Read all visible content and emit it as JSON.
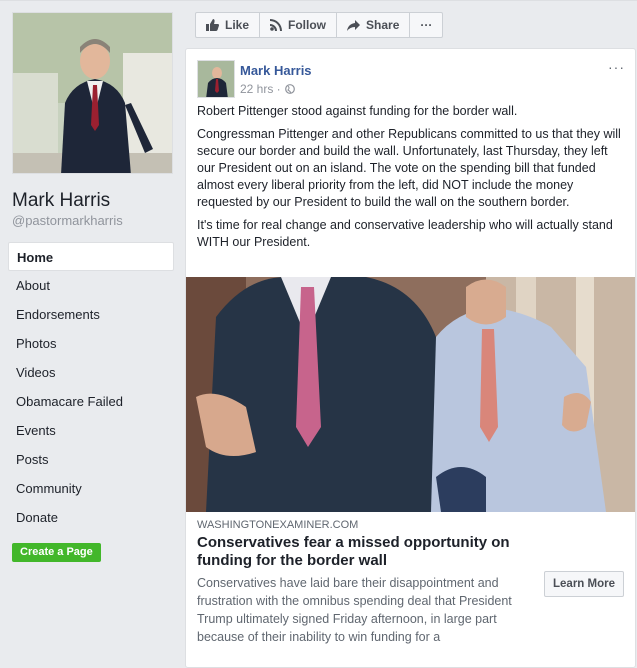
{
  "page": {
    "name": "Mark Harris",
    "handle": "@pastormarkharris"
  },
  "sidebar": {
    "items": [
      {
        "label": "Home",
        "active": true
      },
      {
        "label": "About"
      },
      {
        "label": "Endorsements"
      },
      {
        "label": "Photos"
      },
      {
        "label": "Videos"
      },
      {
        "label": "Obamacare Failed"
      },
      {
        "label": "Events"
      },
      {
        "label": "Posts"
      },
      {
        "label": "Community"
      },
      {
        "label": "Donate"
      }
    ],
    "create_page_label": "Create a Page"
  },
  "actions": {
    "like_label": "Like",
    "follow_label": "Follow",
    "share_label": "Share",
    "more_label": "···"
  },
  "post": {
    "author": "Mark Harris",
    "time": "22 hrs ·",
    "more_label": "···",
    "paragraphs": [
      "Robert Pittenger stood against funding for the border wall.",
      "Congressman Pittenger and other Republicans committed to us that they will secure our border and build the wall. Unfortunately, last Thursday, they left our President out on an island. The vote on the spending bill that funded almost every liberal priority from the left, did NOT include the money requested by our President to build the wall on the southern border.",
      "It's time for real change and conservative leadership who will actually stand WITH our President."
    ],
    "link": {
      "source": "WASHINGTONEXAMINER.COM",
      "title": "Conservatives fear a missed opportunity on funding for the border wall",
      "description": "Conservatives have laid bare their disappointment and frustration with the omnibus spending deal that President Trump ultimately signed Friday afternoon, in large part because of their inability to win funding for a",
      "button_label": "Learn More"
    }
  },
  "colors": {
    "background": "#e9ebee",
    "link_blue": "#365899",
    "green": "#42b72a"
  }
}
